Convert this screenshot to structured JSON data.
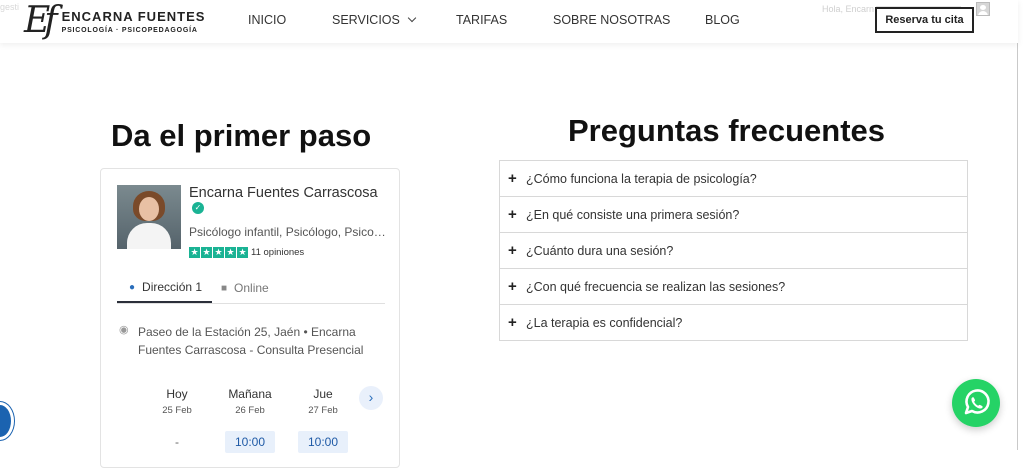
{
  "header": {
    "ghost_left": "gesti",
    "logo": {
      "mark": "Ef",
      "name": "ENCARNA FUENTES",
      "subtitle": "PSICOLOGÍA · PSICOPEDAGOGÍA"
    },
    "nav": [
      {
        "label": "INICIO"
      },
      {
        "label": "SERVICIOS"
      },
      {
        "label": "TARIFAS"
      },
      {
        "label": "SOBRE NOSOTRAS"
      },
      {
        "label": "BLOG"
      }
    ],
    "greeting": "Hola, Encarn",
    "cta": "Reserva tu cita"
  },
  "left": {
    "heading": "Da el primer paso",
    "card": {
      "name": "Encarna Fuentes Carrascosa",
      "specialties": "Psicólogo infantil, Psicólogo, Psico…",
      "reviews": "11 opiniones",
      "rating": 5,
      "tabs": [
        {
          "label": "Dirección 1"
        },
        {
          "label": "Online"
        }
      ],
      "address": "Paseo de la Estación 25, Jaén  •  Encarna Fuentes Carrascosa - Consulta Presencial",
      "slots": [
        {
          "day": "Hoy",
          "date": "25 Feb",
          "time": "-"
        },
        {
          "day": "Mañana",
          "date": "26 Feb",
          "time": "10:00"
        },
        {
          "day": "Jue",
          "date": "27 Feb",
          "time": "10:00"
        }
      ],
      "next": "›"
    }
  },
  "right": {
    "heading": "Preguntas frecuentes",
    "faq": [
      {
        "q": "¿Cómo funciona la terapia de psicología?"
      },
      {
        "q": "¿En qué consiste una primera sesión?"
      },
      {
        "q": "¿Cuánto dura una sesión?"
      },
      {
        "q": "¿Con qué frecuencia se realizan las sesiones?"
      },
      {
        "q": "¿La terapia es confidencial?"
      }
    ]
  },
  "icons": {
    "verified": "verified-check-icon",
    "star": "star-icon",
    "pin": "map-pin-icon",
    "video": "video-camera-icon",
    "whatsapp": "whatsapp-icon"
  },
  "colors": {
    "accent_green": "#1ab394",
    "whatsapp": "#25d366",
    "link_blue": "#2a6ebb"
  }
}
